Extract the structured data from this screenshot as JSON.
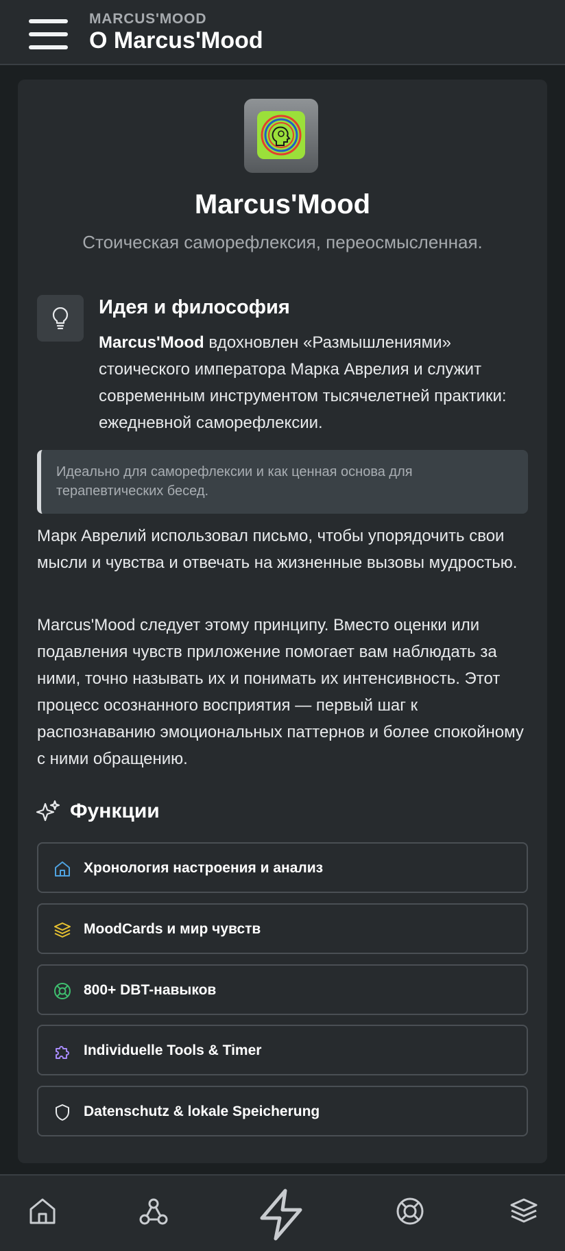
{
  "header": {
    "kicker": "MARCUS'MOOD",
    "title": "O Marcus'Mood"
  },
  "app": {
    "name": "Marcus'Mood",
    "tagline": "Стоическая саморефлексия, переосмысленная."
  },
  "philosophy": {
    "icon": "lightbulb-icon",
    "title": "Идея и философия",
    "intro_bold": "Marcus'Mood",
    "intro_text": " вдохновлен «Размышлениями» стоического императора Марка Аврелия и служит современным инструментом тысячелетней практики: ежедневной саморефлексии.",
    "quote": "Идеально для саморефлексии и как ценная основа для терапевтических бесед.",
    "paragraph1": "Марк Аврелий использовал письмо, чтобы упорядочить свои мысли и чувства и отвечать на жизненные вызовы мудростью.",
    "paragraph2": "Marcus'Mood следует этому принципу. Вместо оценки или подавления чувств приложение помогает вам наблюдать за ними, точно называть их и понимать их интенсивность. Этот процесс осознанного восприятия — первый шаг к распознаванию эмоциональных паттернов и более спокойному с ними обращению."
  },
  "features": {
    "icon": "sparkles-icon",
    "title": "Функции",
    "items": [
      {
        "label": "Хронология настроения и анализ",
        "icon": "home-icon",
        "color": "#4fa3e0"
      },
      {
        "label": "MoodCards и мир чувств",
        "icon": "layers-icon",
        "color": "#e8c230"
      },
      {
        "label": "800+ DBT-навыков",
        "icon": "lifebuoy-icon",
        "color": "#3fbf6f"
      },
      {
        "label": "Individuelle Tools & Timer",
        "icon": "puzzle-icon",
        "color": "#a78bfa"
      },
      {
        "label": "Datenschutz & lokale Speicherung",
        "icon": "shield-icon",
        "color": "#e8eaec"
      }
    ]
  },
  "bottom_nav": {
    "items": [
      "home-icon",
      "webhook-icon",
      "zap-icon",
      "lifebuoy-icon",
      "layers-icon"
    ]
  },
  "colors": {
    "background": "#1b1f21",
    "surface": "#272b2e",
    "logo_bg": "#9be03a",
    "logo_ring_red": "#e2402e",
    "logo_ring_blue": "#1f5fc4"
  }
}
